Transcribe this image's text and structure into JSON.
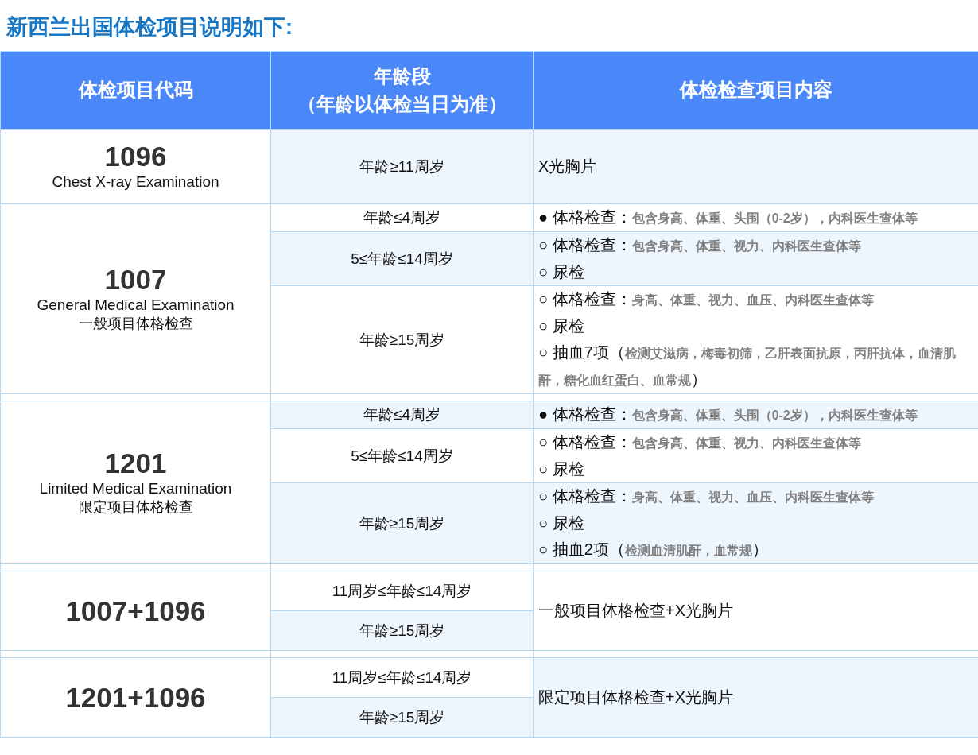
{
  "title": "新西兰出国体检项目说明如下:",
  "table": {
    "columns": [
      {
        "lines": [
          "体检项目代码"
        ]
      },
      {
        "lines": [
          "年龄段",
          "（年龄以体检当日为准）"
        ]
      },
      {
        "lines": [
          "体检检查项目内容"
        ]
      }
    ],
    "groups": [
      {
        "code": "1096",
        "names": [
          "Chest X-ray Examination"
        ],
        "separated": false,
        "rows": [
          {
            "age": "年龄≥11周岁",
            "shaded": true,
            "content": {
              "shaded": true,
              "lines": [
                {
                  "label": "X光胸片"
                }
              ]
            }
          }
        ]
      },
      {
        "code": "1007",
        "names": [
          "General Medical Examination",
          "一般项目体格检查"
        ],
        "separated": false,
        "rows": [
          {
            "age": "年龄≤4周岁",
            "shaded": false,
            "content": {
              "shaded": false,
              "lines": [
                {
                  "bullet": "●",
                  "label": "体格检查：",
                  "detail": "包含身高、体重、头围（0-2岁），内科医生查体等"
                }
              ]
            }
          },
          {
            "age": "5≤年龄≤14周岁",
            "shaded": true,
            "content": {
              "shaded": true,
              "lines": [
                {
                  "bullet": "○",
                  "label": "体格检查：",
                  "detail": "包含身高、体重、视力、内科医生查体等"
                },
                {
                  "bullet": "○",
                  "label": "尿检"
                }
              ]
            }
          },
          {
            "age": "年龄≥15周岁",
            "shaded": false,
            "content": {
              "shaded": false,
              "lines": [
                {
                  "bullet": "○",
                  "label": "体格检查：",
                  "detail": "身高、体重、视力、血压、内科医生查体等"
                },
                {
                  "bullet": "○",
                  "label": "尿检"
                },
                {
                  "bullet": "○",
                  "label": "抽血7项（",
                  "detail": "检测艾滋病，梅毒初筛，乙肝表面抗原，丙肝抗体，血清肌酐，糖化血红蛋白、血常规",
                  "suffix": "）"
                }
              ]
            }
          }
        ]
      },
      {
        "code": "1201",
        "names": [
          "Limited Medical Examination",
          "限定项目体格检查"
        ],
        "separated": true,
        "rows": [
          {
            "age": "年龄≤4周岁",
            "shaded": true,
            "content": {
              "shaded": true,
              "lines": [
                {
                  "bullet": "●",
                  "label": "体格检查：",
                  "detail": "包含身高、体重、头围（0-2岁），内科医生查体等"
                }
              ]
            }
          },
          {
            "age": "5≤年龄≤14周岁",
            "shaded": false,
            "content": {
              "shaded": false,
              "lines": [
                {
                  "bullet": "○",
                  "label": "体格检查：",
                  "detail": "包含身高、体重、视力、内科医生查体等"
                },
                {
                  "bullet": "○",
                  "label": "尿检"
                }
              ]
            }
          },
          {
            "age": "年龄≥15周岁",
            "shaded": true,
            "content": {
              "shaded": true,
              "lines": [
                {
                  "bullet": "○",
                  "label": "体格检查：",
                  "detail": "身高、体重、视力、血压、内科医生查体等"
                },
                {
                  "bullet": "○",
                  "label": "尿检"
                },
                {
                  "bullet": "○",
                  "label": "抽血2项（",
                  "detail": "检测血清肌酐，血常规",
                  "suffix": "）"
                }
              ]
            }
          }
        ]
      },
      {
        "code": "1007+1096",
        "separated": true,
        "shared_content": {
          "shaded": false,
          "lines": [
            {
              "label": "一般项目体格检查+X光胸片"
            }
          ]
        },
        "rows": [
          {
            "age": "11周岁≤年龄≤14周岁",
            "shaded": false
          },
          {
            "age": "年龄≥15周岁",
            "shaded": true
          }
        ]
      },
      {
        "code": "1201+1096",
        "separated": true,
        "shared_content": {
          "shaded": true,
          "lines": [
            {
              "label": "限定项目体格检查+X光胸片"
            }
          ]
        },
        "rows": [
          {
            "age": "11周岁≤年龄≤14周岁",
            "shaded": false
          },
          {
            "age": "年龄≥15周岁",
            "shaded": true
          }
        ]
      }
    ]
  }
}
